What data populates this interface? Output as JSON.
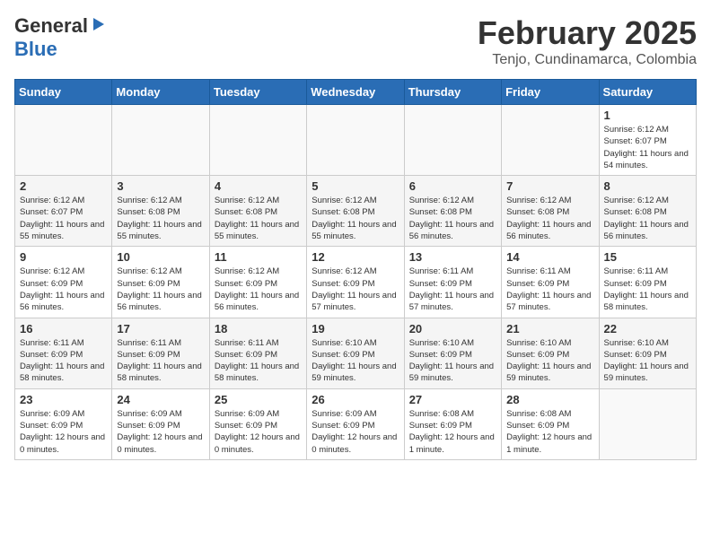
{
  "header": {
    "logo_general": "General",
    "logo_blue": "Blue",
    "title": "February 2025",
    "subtitle": "Tenjo, Cundinamarca, Colombia"
  },
  "weekdays": [
    "Sunday",
    "Monday",
    "Tuesday",
    "Wednesday",
    "Thursday",
    "Friday",
    "Saturday"
  ],
  "weeks": [
    [
      {
        "day": "",
        "info": ""
      },
      {
        "day": "",
        "info": ""
      },
      {
        "day": "",
        "info": ""
      },
      {
        "day": "",
        "info": ""
      },
      {
        "day": "",
        "info": ""
      },
      {
        "day": "",
        "info": ""
      },
      {
        "day": "1",
        "info": "Sunrise: 6:12 AM\nSunset: 6:07 PM\nDaylight: 11 hours\nand 54 minutes."
      }
    ],
    [
      {
        "day": "2",
        "info": "Sunrise: 6:12 AM\nSunset: 6:07 PM\nDaylight: 11 hours\nand 55 minutes."
      },
      {
        "day": "3",
        "info": "Sunrise: 6:12 AM\nSunset: 6:08 PM\nDaylight: 11 hours\nand 55 minutes."
      },
      {
        "day": "4",
        "info": "Sunrise: 6:12 AM\nSunset: 6:08 PM\nDaylight: 11 hours\nand 55 minutes."
      },
      {
        "day": "5",
        "info": "Sunrise: 6:12 AM\nSunset: 6:08 PM\nDaylight: 11 hours\nand 55 minutes."
      },
      {
        "day": "6",
        "info": "Sunrise: 6:12 AM\nSunset: 6:08 PM\nDaylight: 11 hours\nand 56 minutes."
      },
      {
        "day": "7",
        "info": "Sunrise: 6:12 AM\nSunset: 6:08 PM\nDaylight: 11 hours\nand 56 minutes."
      },
      {
        "day": "8",
        "info": "Sunrise: 6:12 AM\nSunset: 6:08 PM\nDaylight: 11 hours\nand 56 minutes."
      }
    ],
    [
      {
        "day": "9",
        "info": "Sunrise: 6:12 AM\nSunset: 6:09 PM\nDaylight: 11 hours\nand 56 minutes."
      },
      {
        "day": "10",
        "info": "Sunrise: 6:12 AM\nSunset: 6:09 PM\nDaylight: 11 hours\nand 56 minutes."
      },
      {
        "day": "11",
        "info": "Sunrise: 6:12 AM\nSunset: 6:09 PM\nDaylight: 11 hours\nand 56 minutes."
      },
      {
        "day": "12",
        "info": "Sunrise: 6:12 AM\nSunset: 6:09 PM\nDaylight: 11 hours\nand 57 minutes."
      },
      {
        "day": "13",
        "info": "Sunrise: 6:11 AM\nSunset: 6:09 PM\nDaylight: 11 hours\nand 57 minutes."
      },
      {
        "day": "14",
        "info": "Sunrise: 6:11 AM\nSunset: 6:09 PM\nDaylight: 11 hours\nand 57 minutes."
      },
      {
        "day": "15",
        "info": "Sunrise: 6:11 AM\nSunset: 6:09 PM\nDaylight: 11 hours\nand 58 minutes."
      }
    ],
    [
      {
        "day": "16",
        "info": "Sunrise: 6:11 AM\nSunset: 6:09 PM\nDaylight: 11 hours\nand 58 minutes."
      },
      {
        "day": "17",
        "info": "Sunrise: 6:11 AM\nSunset: 6:09 PM\nDaylight: 11 hours\nand 58 minutes."
      },
      {
        "day": "18",
        "info": "Sunrise: 6:11 AM\nSunset: 6:09 PM\nDaylight: 11 hours\nand 58 minutes."
      },
      {
        "day": "19",
        "info": "Sunrise: 6:10 AM\nSunset: 6:09 PM\nDaylight: 11 hours\nand 59 minutes."
      },
      {
        "day": "20",
        "info": "Sunrise: 6:10 AM\nSunset: 6:09 PM\nDaylight: 11 hours\nand 59 minutes."
      },
      {
        "day": "21",
        "info": "Sunrise: 6:10 AM\nSunset: 6:09 PM\nDaylight: 11 hours\nand 59 minutes."
      },
      {
        "day": "22",
        "info": "Sunrise: 6:10 AM\nSunset: 6:09 PM\nDaylight: 11 hours\nand 59 minutes."
      }
    ],
    [
      {
        "day": "23",
        "info": "Sunrise: 6:09 AM\nSunset: 6:09 PM\nDaylight: 12 hours\nand 0 minutes."
      },
      {
        "day": "24",
        "info": "Sunrise: 6:09 AM\nSunset: 6:09 PM\nDaylight: 12 hours\nand 0 minutes."
      },
      {
        "day": "25",
        "info": "Sunrise: 6:09 AM\nSunset: 6:09 PM\nDaylight: 12 hours\nand 0 minutes."
      },
      {
        "day": "26",
        "info": "Sunrise: 6:09 AM\nSunset: 6:09 PM\nDaylight: 12 hours\nand 0 minutes."
      },
      {
        "day": "27",
        "info": "Sunrise: 6:08 AM\nSunset: 6:09 PM\nDaylight: 12 hours\nand 1 minute."
      },
      {
        "day": "28",
        "info": "Sunrise: 6:08 AM\nSunset: 6:09 PM\nDaylight: 12 hours\nand 1 minute."
      },
      {
        "day": "",
        "info": ""
      }
    ]
  ]
}
